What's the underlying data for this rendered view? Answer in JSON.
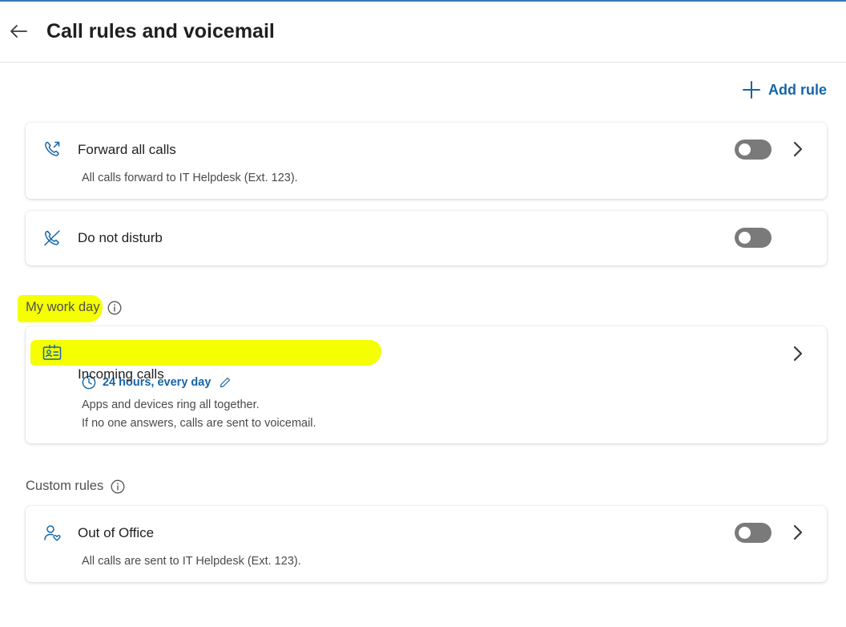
{
  "header": {
    "title": "Call rules and voicemail"
  },
  "toolbar": {
    "add_rule_label": "Add rule"
  },
  "rules": {
    "forward": {
      "title": "Forward all calls",
      "description": "All calls forward to IT Helpdesk (Ext. 123).",
      "enabled": false
    },
    "dnd": {
      "title": "Do not disturb",
      "enabled": false
    }
  },
  "workday": {
    "label": "My work day",
    "incoming": {
      "title": "Incoming calls",
      "schedule": "24 hours, every day",
      "line1": "Apps and devices ring all together.",
      "line2": "If no one answers, calls are sent to voicemail."
    }
  },
  "custom": {
    "label": "Custom rules",
    "out_of_office": {
      "title": "Out of Office",
      "description": "All calls are sent to IT Helpdesk (Ext. 123).",
      "enabled": false
    }
  },
  "colors": {
    "accent": "#1565a8",
    "highlight": "#f5ff00",
    "toggle_off": "#7a7a7a"
  },
  "icons": [
    "back-arrow-icon",
    "plus-icon",
    "phone-forward-icon",
    "phone-muted-icon",
    "info-icon",
    "contact-card-icon",
    "clock-icon",
    "pencil-icon",
    "person-heart-icon",
    "chevron-right-icon"
  ]
}
